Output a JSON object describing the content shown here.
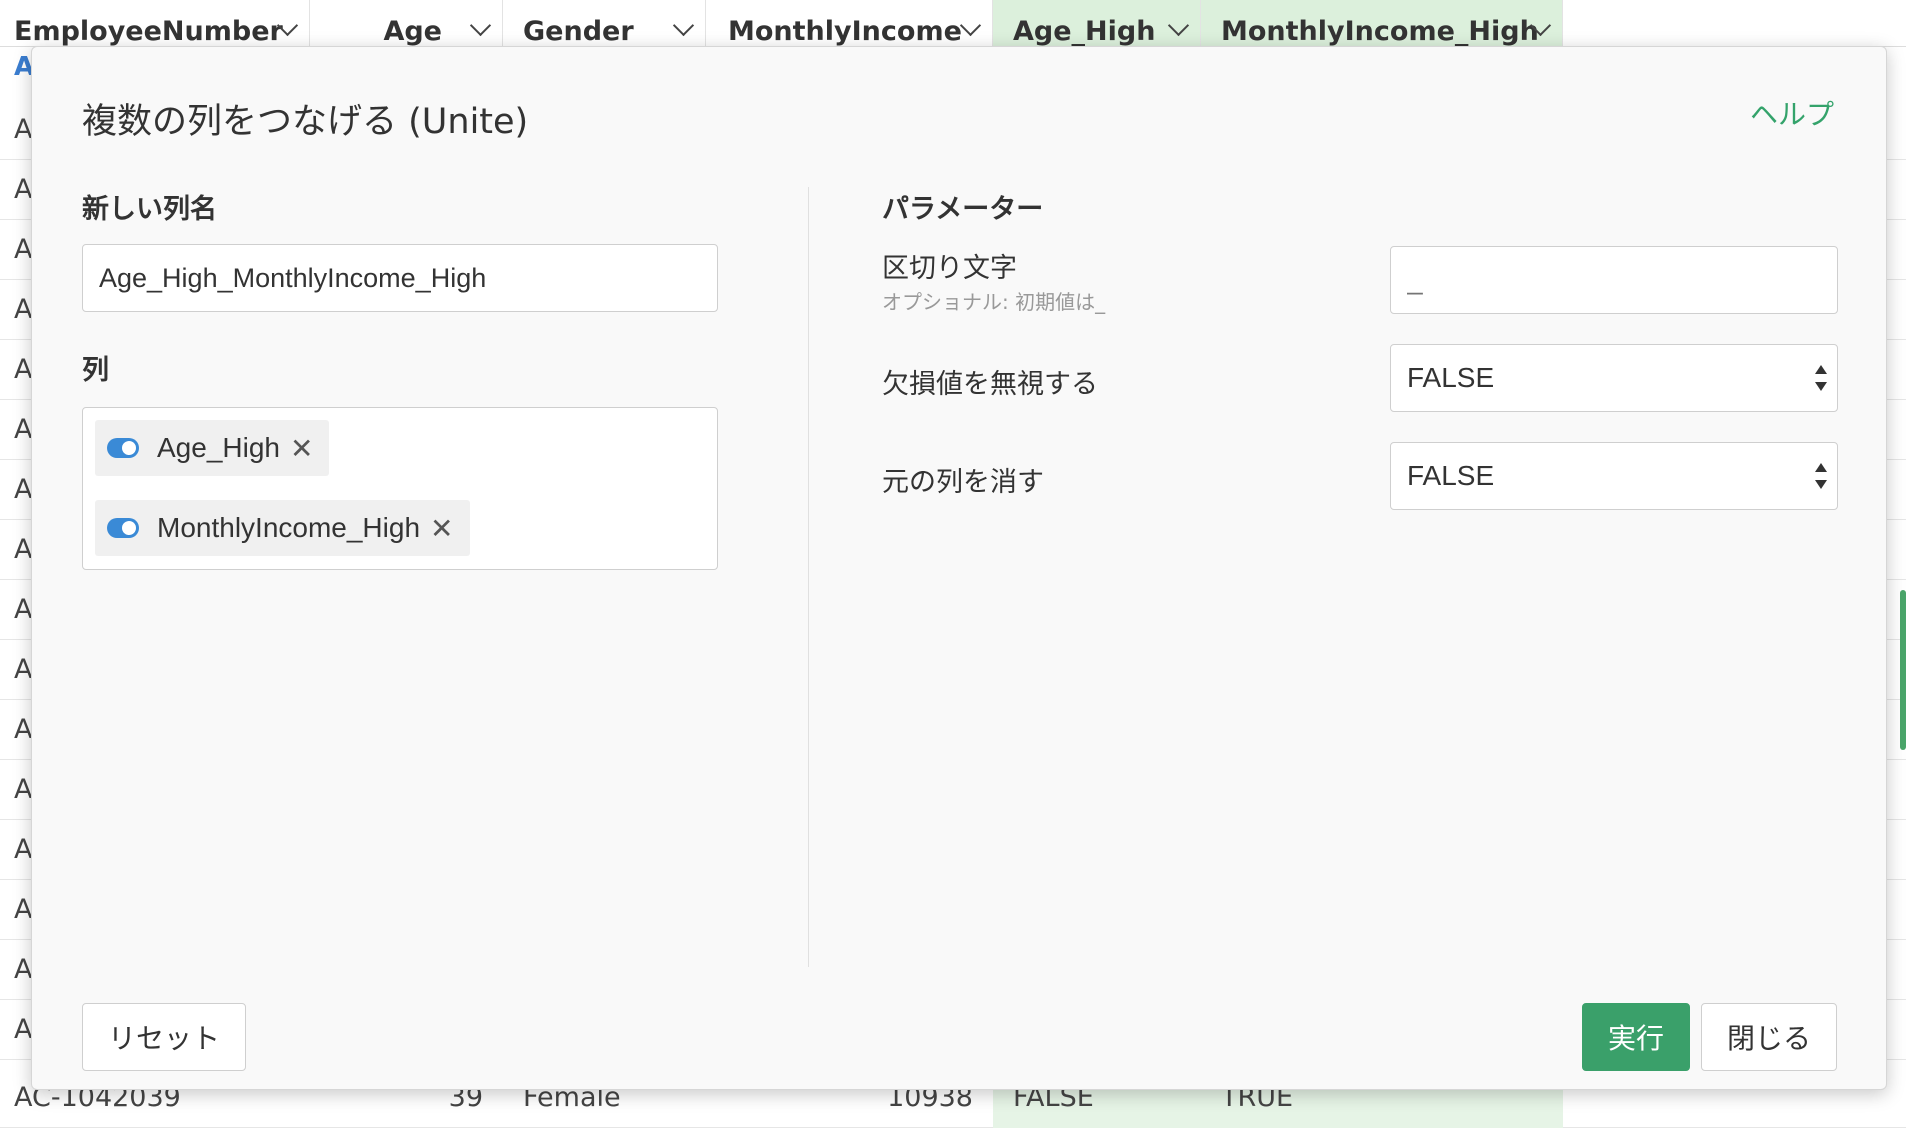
{
  "grid": {
    "columns": [
      {
        "name": "EmployeeNumber",
        "type": "A"
      },
      {
        "name": "Age"
      },
      {
        "name": "Gender"
      },
      {
        "name": "MonthlyIncome"
      },
      {
        "name": "Age_High"
      },
      {
        "name": "MonthlyIncome_High"
      }
    ],
    "row_prefix": "A",
    "last_row": {
      "employee": "AC-1042039",
      "age": "39",
      "gender": "Female",
      "income": "10938",
      "age_high": "FALSE",
      "income_high": "TRUE"
    }
  },
  "dialog": {
    "title": "複数の列をつなげる (Unite)",
    "help": "ヘルプ",
    "new_column_label": "新しい列名",
    "new_column_value": "Age_High_MonthlyIncome_High",
    "columns_label": "列",
    "columns": [
      {
        "label": "Age_High"
      },
      {
        "label": "MonthlyIncome_High"
      }
    ],
    "remove_glyph": "✕",
    "params_title": "パラメーター",
    "separator_label": "区切り文字",
    "separator_hint": "オプショナル: 初期値は_",
    "separator_placeholder": "_",
    "ignore_na_label": "欠損値を無視する",
    "ignore_na_value": "FALSE",
    "remove_original_label": "元の列を消す",
    "remove_original_value": "FALSE",
    "reset_button": "リセット",
    "run_button": "実行",
    "close_button": "閉じる"
  },
  "colors": {
    "accent_green": "#3aa06a",
    "toggle_blue": "#3a8ad6",
    "highlight_column": "#dcf0dc"
  }
}
